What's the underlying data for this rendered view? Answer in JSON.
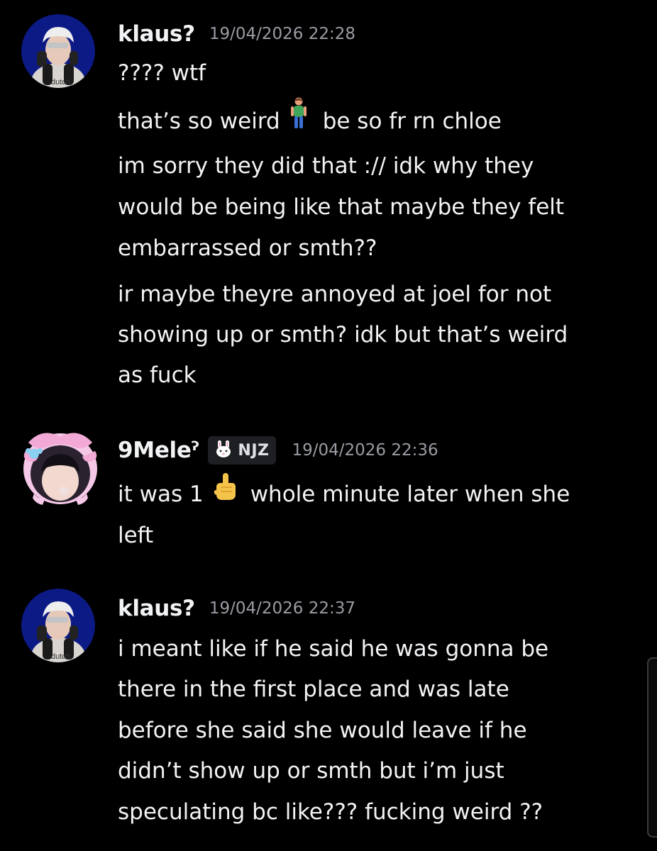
{
  "messages": [
    {
      "username": "klaus?",
      "timestamp": "19/04/2026 22:28",
      "avatar_caption": "dutch",
      "lines": [
        "???? wtf",
        "that’s so weird",
        "be so fr rn chloe",
        "im sorry they did that :// idk why they",
        "would be being like that maybe they felt",
        "embarrassed or smth??",
        "ir maybe theyre annoyed at joel for not",
        "showing up or smth? idk but that’s weird",
        "as fuck"
      ],
      "emojis": [
        "person-standing-emoji"
      ]
    },
    {
      "username": "9Meleˀ",
      "tag": "NJZ",
      "tag_icon": "bunny-icon",
      "timestamp": "19/04/2026 22:36",
      "lines": [
        "it was 1",
        "whole minute later when she",
        "left"
      ],
      "emojis": [
        "index-pointing-up-emoji"
      ]
    },
    {
      "username": "klaus?",
      "timestamp": "19/04/2026 22:37",
      "avatar_caption": "dutch",
      "lines": [
        "i meant like if he said he was gonna be",
        "there in the first place and was late",
        "before she said she would leave if he",
        "didn’t show up or smth but i’m just",
        "speculating bc like??? fucking weird ??"
      ]
    }
  ],
  "colors": {
    "background": "#000000",
    "text": "#f2f3f5",
    "timestamp": "#9a9ca3",
    "tag_bg": "#1e1f22"
  }
}
